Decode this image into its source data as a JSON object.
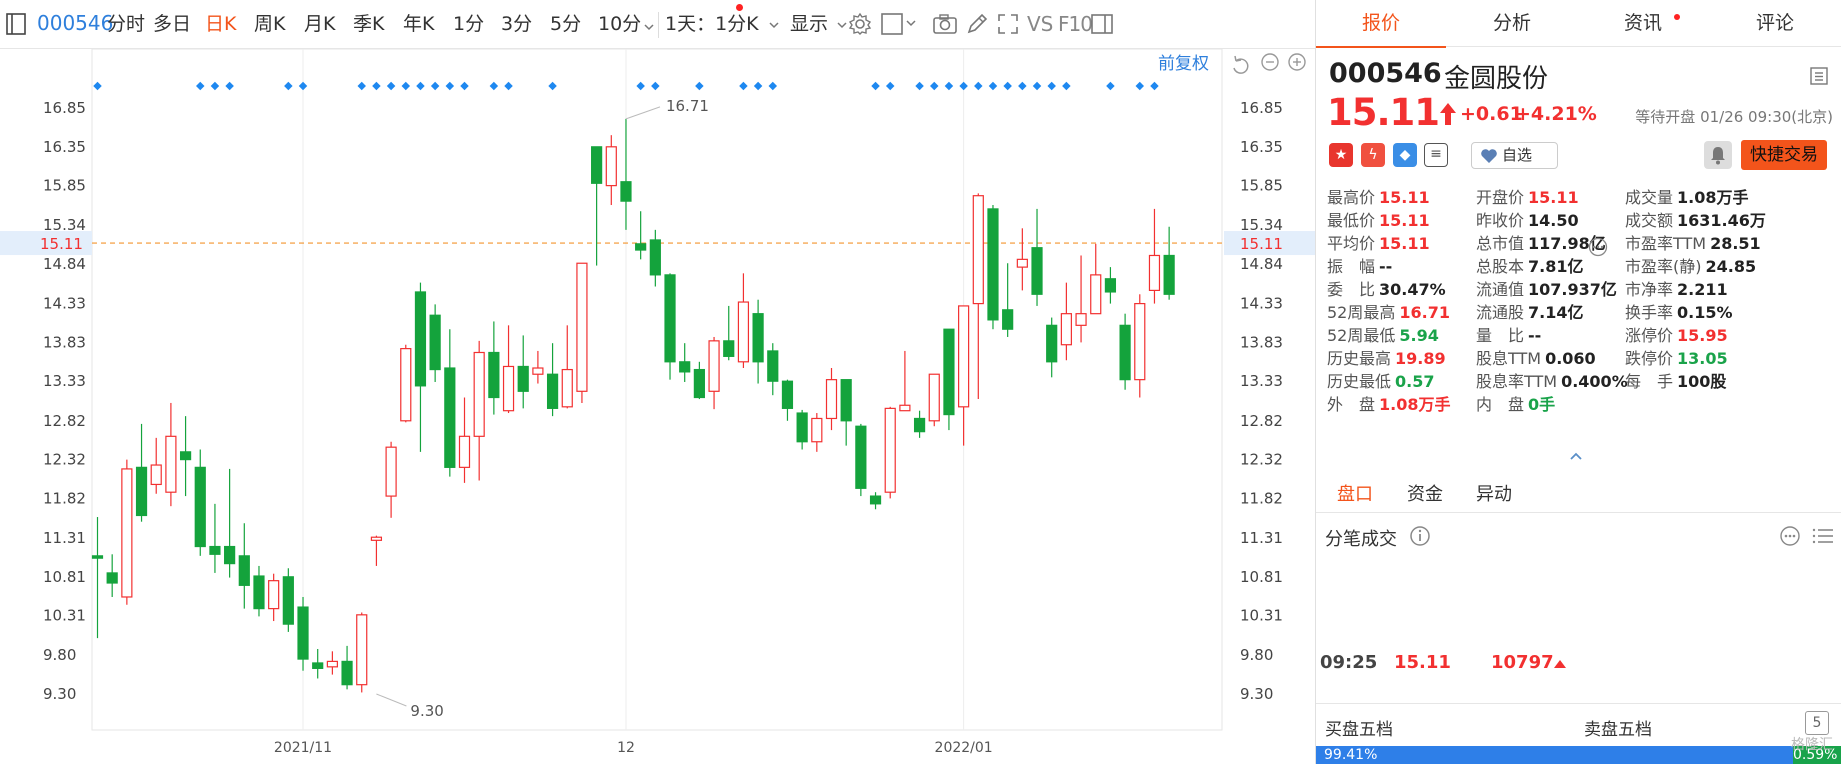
{
  "toolbar": {
    "code": "000546",
    "tabs": [
      "分时",
      "多日",
      "日K",
      "周K",
      "月K",
      "季K",
      "年K",
      "1分",
      "3分",
      "5分",
      "10分"
    ],
    "active_tab": "日K",
    "period_select": "1天：1分K",
    "display_label": "显示",
    "vs_label": "VS",
    "f10_label": "F10"
  },
  "chart_toolbar": {
    "adjust_label": "前复权"
  },
  "chart_data": {
    "type": "candlestick",
    "y_ticks": [
      "16.85",
      "16.35",
      "15.85",
      "15.34",
      "14.84",
      "14.33",
      "13.83",
      "13.33",
      "12.82",
      "12.32",
      "11.82",
      "11.31",
      "10.81",
      "10.31",
      "9.80",
      "9.30"
    ],
    "ylim": [
      9.3,
      16.85
    ],
    "x_labels": [
      {
        "label": "2021/11",
        "index": 14
      },
      {
        "label": "12",
        "index": 36
      },
      {
        "label": "2022/01",
        "index": 59
      }
    ],
    "current_price": "15.11",
    "max_label": {
      "value": "16.71",
      "index": 36
    },
    "min_label": {
      "value": "9.30",
      "index": 19
    },
    "candles": [
      [
        11.08,
        11.05,
        11.58,
        10.02
      ],
      [
        10.86,
        10.73,
        11.1,
        10.55
      ],
      [
        10.55,
        12.2,
        12.32,
        10.45
      ],
      [
        12.22,
        11.6,
        12.78,
        11.52
      ],
      [
        12.0,
        12.25,
        12.6,
        11.88
      ],
      [
        11.9,
        12.62,
        13.05,
        11.72
      ],
      [
        12.42,
        12.32,
        12.88,
        11.85
      ],
      [
        12.22,
        11.2,
        12.45,
        11.08
      ],
      [
        11.2,
        11.1,
        11.75,
        10.86
      ],
      [
        11.2,
        10.98,
        12.2,
        10.8
      ],
      [
        11.08,
        10.7,
        11.5,
        10.4
      ],
      [
        10.82,
        10.4,
        10.95,
        10.3
      ],
      [
        10.4,
        10.76,
        10.85,
        10.24
      ],
      [
        10.81,
        10.2,
        10.92,
        10.1
      ],
      [
        10.42,
        9.75,
        10.55,
        9.6
      ],
      [
        9.7,
        9.63,
        9.88,
        9.5
      ],
      [
        9.65,
        9.72,
        9.85,
        9.55
      ],
      [
        9.72,
        9.42,
        9.92,
        9.36
      ],
      [
        9.42,
        10.32,
        10.35,
        9.32
      ],
      [
        11.28,
        11.32,
        11.34,
        10.95
      ],
      [
        11.85,
        12.48,
        12.55,
        11.57
      ],
      [
        12.82,
        13.75,
        13.8,
        12.8
      ],
      [
        14.48,
        13.27,
        14.6,
        12.42
      ],
      [
        14.18,
        13.48,
        14.32,
        13.32
      ],
      [
        13.5,
        12.22,
        14.0,
        12.1
      ],
      [
        12.22,
        12.62,
        13.12,
        12.02
      ],
      [
        12.62,
        13.7,
        13.85,
        12.05
      ],
      [
        13.7,
        13.12,
        14.1,
        12.9
      ],
      [
        12.95,
        13.52,
        14.05,
        12.92
      ],
      [
        13.52,
        13.2,
        13.92,
        12.98
      ],
      [
        13.42,
        13.5,
        13.72,
        13.3
      ],
      [
        13.42,
        12.98,
        13.82,
        12.88
      ],
      [
        13.0,
        13.48,
        14.05,
        12.98
      ],
      [
        13.2,
        14.85,
        14.85,
        13.05
      ],
      [
        16.35,
        15.88,
        16.35,
        14.82
      ],
      [
        15.85,
        16.35,
        16.5,
        15.6
      ],
      [
        15.9,
        15.65,
        16.71,
        15.28
      ],
      [
        15.1,
        15.02,
        15.52,
        14.9
      ],
      [
        15.15,
        14.7,
        15.28,
        14.55
      ],
      [
        14.7,
        13.58,
        14.72,
        13.35
      ],
      [
        13.58,
        13.45,
        13.82,
        13.32
      ],
      [
        13.48,
        13.12,
        13.58,
        13.1
      ],
      [
        13.2,
        13.85,
        13.9,
        12.97
      ],
      [
        13.85,
        13.65,
        14.3,
        13.6
      ],
      [
        13.58,
        14.35,
        14.72,
        13.5
      ],
      [
        14.2,
        13.58,
        14.38,
        13.3
      ],
      [
        13.72,
        13.33,
        13.82,
        13.15
      ],
      [
        13.33,
        12.98,
        13.35,
        12.82
      ],
      [
        12.92,
        12.55,
        12.96,
        12.45
      ],
      [
        12.55,
        12.85,
        12.92,
        12.42
      ],
      [
        12.85,
        13.35,
        13.5,
        12.7
      ],
      [
        13.35,
        12.82,
        13.35,
        12.5
      ],
      [
        12.75,
        11.95,
        12.78,
        11.85
      ],
      [
        11.85,
        11.75,
        11.9,
        11.68
      ],
      [
        11.9,
        12.98,
        13.0,
        11.82
      ],
      [
        12.95,
        13.02,
        13.72,
        12.95
      ],
      [
        12.85,
        12.68,
        12.95,
        12.6
      ],
      [
        12.82,
        13.42,
        13.42,
        12.75
      ],
      [
        14.0,
        12.9,
        14.0,
        12.7
      ],
      [
        13.0,
        14.3,
        14.3,
        12.5
      ],
      [
        14.33,
        15.72,
        15.75,
        13.1
      ],
      [
        15.55,
        14.12,
        15.6,
        14.0
      ],
      [
        14.25,
        14.0,
        14.85,
        13.9
      ],
      [
        14.8,
        14.9,
        15.3,
        14.5
      ],
      [
        15.05,
        14.45,
        15.55,
        14.3
      ],
      [
        14.05,
        13.58,
        14.15,
        13.38
      ],
      [
        13.8,
        14.2,
        14.6,
        13.6
      ],
      [
        14.05,
        14.2,
        14.95,
        13.83
      ],
      [
        14.2,
        14.7,
        15.1,
        14.2
      ],
      [
        14.65,
        14.48,
        14.8,
        14.33
      ],
      [
        14.05,
        13.35,
        14.2,
        13.22
      ],
      [
        13.35,
        14.33,
        14.45,
        13.12
      ],
      [
        14.5,
        14.95,
        15.55,
        14.33
      ],
      [
        14.95,
        14.45,
        15.32,
        14.38
      ]
    ],
    "markers": [
      0,
      7,
      8,
      9,
      13,
      14,
      18,
      19,
      20,
      21,
      22,
      23,
      24,
      25,
      27,
      28,
      31,
      37,
      38,
      41,
      44,
      45,
      46,
      53,
      54,
      56,
      57,
      58,
      59,
      60,
      61,
      62,
      63,
      64,
      65,
      66,
      69,
      71,
      72
    ],
    "colors": {
      "up": "#f23030",
      "down": "#14a33c",
      "marker": "#1e88f0",
      "price_line": "#f3952e"
    }
  },
  "panel": {
    "tabs": [
      "报价",
      "分析",
      "资讯",
      "评论"
    ],
    "active_tab": "报价",
    "code": "000546",
    "name": "金圆股份",
    "price": "15.11",
    "change": "+0.61",
    "change_pct": "+4.21%",
    "status": "等待开盘 01/26 09:30(北京)",
    "zixuan_label": "自选",
    "fast_trade_label": "快捷交易",
    "quotes": [
      {
        "label": "最高价",
        "value": "15.11",
        "color": "red"
      },
      {
        "label": "开盘价",
        "value": "15.11",
        "color": "red"
      },
      {
        "label": "成交量",
        "value": "1.08万手",
        "color": ""
      },
      {
        "label": "最低价",
        "value": "15.11",
        "color": "red"
      },
      {
        "label": "昨收价",
        "value": "14.50",
        "color": ""
      },
      {
        "label": "成交额",
        "value": "1631.46万",
        "color": ""
      },
      {
        "label": "平均价",
        "value": "15.11",
        "color": "red"
      },
      {
        "label": "总市值",
        "value": "117.98亿",
        "color": ""
      },
      {
        "label": "市盈率TTM",
        "value": "28.51",
        "color": ""
      },
      {
        "label": "振　幅",
        "value": "--",
        "color": ""
      },
      {
        "label": "总股本",
        "value": "7.81亿",
        "color": ""
      },
      {
        "label": "市盈率(静)",
        "value": "24.85",
        "color": ""
      },
      {
        "label": "委　比",
        "value": "30.47%",
        "color": ""
      },
      {
        "label": "流通值",
        "value": "107.937亿",
        "color": ""
      },
      {
        "label": "市净率",
        "value": "2.211",
        "color": ""
      },
      {
        "label": "52周最高",
        "value": "16.71",
        "color": "red"
      },
      {
        "label": "流通股",
        "value": "7.14亿",
        "color": ""
      },
      {
        "label": "换手率",
        "value": "0.15%",
        "color": ""
      },
      {
        "label": "52周最低",
        "value": "5.94",
        "color": "green"
      },
      {
        "label": "量　比",
        "value": "--",
        "color": ""
      },
      {
        "label": "涨停价",
        "value": "15.95",
        "color": "red"
      },
      {
        "label": "历史最高",
        "value": "19.89",
        "color": "red"
      },
      {
        "label": "股息TTM",
        "value": "0.060",
        "color": ""
      },
      {
        "label": "跌停价",
        "value": "13.05",
        "color": "green"
      },
      {
        "label": "历史最低",
        "value": "0.57",
        "color": "green"
      },
      {
        "label": "股息率TTM",
        "value": "0.400%",
        "color": ""
      },
      {
        "label": "每　手",
        "value": "100股",
        "color": ""
      },
      {
        "label": "外　盘",
        "value": "1.08万手",
        "color": "red"
      },
      {
        "label": "内　盘",
        "value": "0手",
        "color": "green"
      },
      {
        "label": "",
        "value": "",
        "color": ""
      }
    ],
    "subtabs": [
      "盘口",
      "资金",
      "异动"
    ],
    "active_subtab": "盘口",
    "ticks_title": "分笔成交",
    "tick": {
      "time": "09:25",
      "price": "15.11",
      "volume": "10797"
    },
    "buy5_label": "买盘五档",
    "sell5_label": "卖盘五档",
    "buy_pct": "99.41%",
    "sell_pct": "0.59%",
    "watermark": "格隆汇"
  }
}
